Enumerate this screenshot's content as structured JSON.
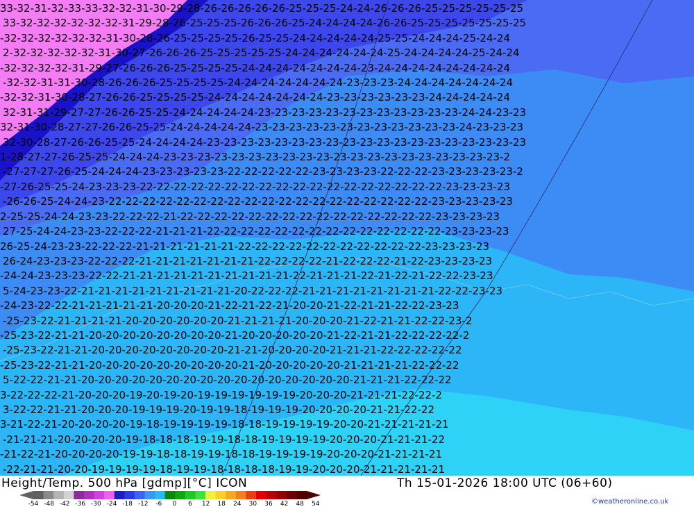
{
  "map": {
    "title_left": "Height/Temp. 500 hPa [gdmp][°C] ICON",
    "title_right": "Th 15-01-2026 18:00 UTC (06+60)",
    "credit": "©weatheronline.co.uk",
    "legend": {
      "tick_labels": [
        "-54",
        "-48",
        "-42",
        "-36",
        "-30",
        "-24",
        "-18",
        "-12",
        "-6",
        "0",
        "6",
        "12",
        "18",
        "24",
        "30",
        "36",
        "42",
        "48",
        "54"
      ],
      "colors": [
        "#606060",
        "#8a8a8a",
        "#b4b4b4",
        "#d2d2d2",
        "#8c2c9c",
        "#b030c0",
        "#d040e0",
        "#f060f0",
        "#1e1ebc",
        "#2a3ce0",
        "#3c66f0",
        "#3c96f8",
        "#2ab8f8",
        "#0a8a0a",
        "#10a810",
        "#20c820",
        "#40e040",
        "#f0f040",
        "#f8d030",
        "#f8a820",
        "#f08020",
        "#e84010",
        "#e00000",
        "#b80000",
        "#900000",
        "#700000",
        "#500000"
      ]
    },
    "temperature_bands": [
      {
        "temp_c": -33,
        "color": "#f47cf4"
      },
      {
        "temp_c": -30,
        "color": "#1a12c8"
      },
      {
        "temp_c": -27,
        "color": "#3c48ec"
      },
      {
        "temp_c": -25,
        "color": "#4a6cf4"
      },
      {
        "temp_c": -23,
        "color": "#3d8cf6"
      },
      {
        "temp_c": -21,
        "color": "#2cb6f8"
      },
      {
        "temp_c": -19,
        "color": "#2dd2f6"
      }
    ],
    "contour_rows": [
      "33-32-31-32-33-33-32-32-31-30-29-28-26-26-26-26-26-25-25-25-24-24-26-26-26-25-25-25-25-25-25",
      "33-32-32-32-32-32-32-31-29-28-26-25-25-25-26-26-26-25-24-24-24-24-26-26-25-25-25-25-25-25-25",
      "-32-32-32-32-32-32-31-30-28-26-25-25-25-25-26-25-25-24-24-24-24-24-25-25-24-24-24-25-24-24",
      "2-32-32-32-32-32-31-30-27-26-26-26-25-25-25-25-25-24-24-24-24-24-24-25-24-24-24-24-25-24-24",
      "-32-32-32-32-31-29-27-26-26-26-25-25-25-25-24-24-24-24-24-24-24-23-24-24-24-24-24-24-24-24",
      "-32-32-31-31-30-28-26-26-26-25-25-25-25-24-24-24-24-24-24-24-23-23-23-24-24-24-24-24-24-24",
      "-32-32-31-30-28-27-26-26-25-25-25-25-24-24-24-24-24-24-24-23-23-23-23-23-23-24-24-24-24-24",
      "32-31-31-29-27-27-26-26-25-25-24-24-24-24-24-23-23-23-23-23-23-23-23-23-23-23-23-24-24-23-23",
      "32-31-30-28-27-27-26-26-25-25-24-24-24-24-24-23-23-23-23-23-23-23-23-23-23-23-23-24-23-23-23",
      "32-30-28-27-26-26-25-25-24-24-24-24-23-23-23-23-23-23-23-23-23-23-23-23-23-23-23-23-23-23-23",
      "1-28-27-27-26-25-25-24-24-24-23-23-23-23-23-23-23-23-23-23-23-23-23-23-23-23-23-23-23-23-2",
      "-27-27-27-26-25-24-24-24-23-23-23-23-23-22-22-22-22-22-23-23-23-23-22-22-22-23-23-23-23-23-2",
      "-27-26-25-25-24-23-23-23-22-22-22-22-22-22-22-22-22-22-22-22-22-22-22-22-22-22-23-23-23-23",
      "-26-26-25-24-24-23-22-22-22-22-22-22-22-22-22-22-22-22-22-22-22-22-22-22-22-23-23-23-23-23",
      "2-25-25-24-24-23-23-22-22-22-21-22-22-22-22-22-22-22-22-22-22-22-22-22-22-22-23-23-23-23",
      "27-25-24-24-23-23-22-22-22-21-21-21-22-22-22-22-22-22-22-22-22-22-22-22-22-22-23-23-23-23",
      "26-25-24-23-23-22-22-22-21-21-21-21-21-21-22-22-22-22-22-22-22-22-22-22-22-23-23-23-23",
      "26-24-23-23-23-22-22-22-21-21-21-21-21-21-21-22-22-22-22-21-22-22-22-21-22-23-23-23-23",
      "-24-24-23-23-23-22-22-21-21-21-21-21-21-21-21-21-21-22-21-21-21-22-21-22-21-22-22-23-23",
      "5-24-23-23-22-21-21-21-21-21-21-21-21-21-20-22-22-22-21-21-21-21-21-21-21-21-22-22-23-23",
      "-24-23-22-22-21-21-21-21-21-20-20-20-21-22-21-22-21-20-20-21-22-21-21-22-22-23-23",
      "-25-23-22-21-21-21-21-20-20-20-20-20-20-21-21-21-21-20-20-20-21-22-21-21-22-22-23-2",
      "-25-23-22-21-21-20-20-20-20-20-20-20-20-21-20-20-20-20-20-21-22-21-21-22-22-22-22-2",
      "-25-23-22-21-21-20-20-20-20-20-20-20-20-21-21-20-20-20-20-21-21-21-22-22-22-22-22",
      "-25-23-22-21-21-20-20-20-20-20-20-20-20-20-21-20-20-20-20-20-21-21-21-21-22-22-22",
      "5-22-22-21-21-20-20-20-20-20-20-20-20-20-20-20-20-20-20-20-20-21-21-21-22-22-22",
      "3-22-22-22-21-20-20-20-19-20-19-20-19-19-19-19-19-19-20-20-20-21-21-21-22-22-2",
      "3-22-22-21-21-20-20-20-19-19-19-20-19-19-18-19-19-19-20-20-20-20-21-21-22-22",
      "3-21-22-21-20-20-20-20-19-18-19-19-19-19-18-18-19-19-19-19-20-20-21-21-21-21-21",
      "-21-21-21-20-20-20-20-19-18-18-18-19-19-18-18-19-19-19-19-20-20-20-21-21-21-22",
      "-21-22-21-20-20-20-20-19-19-18-18-19-19-18-18-19-19-19-19-20-20-20-21-21-21-21",
      "-22-21-21-20-20-19-19-19-19-18-19-19-18-18-18-18-19-19-20-20-20-21-21-21-21-21"
    ]
  }
}
